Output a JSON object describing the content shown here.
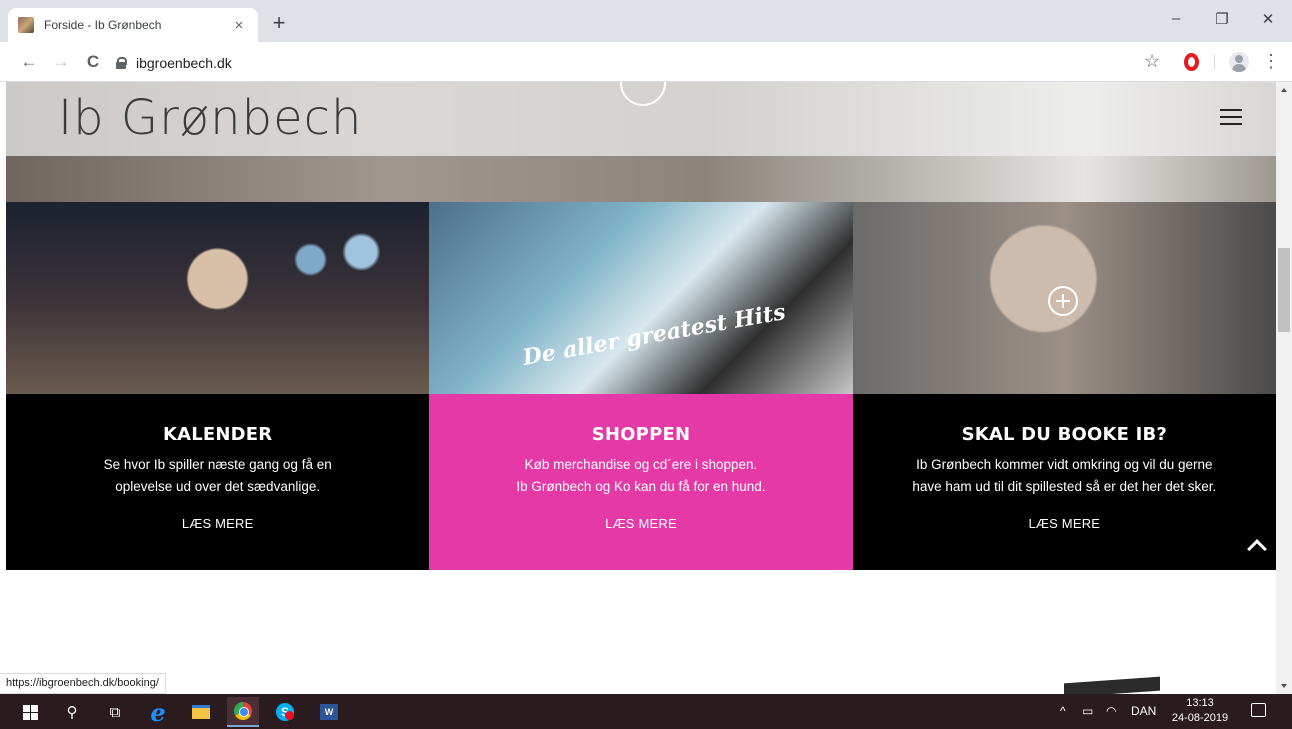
{
  "browser": {
    "tab_title": "Forside - Ib Grønbech",
    "tab_close": "×",
    "new_tab": "+",
    "url": "ibgroenbech.dk",
    "window_controls": {
      "minimize": "–",
      "restore": "❐",
      "close": "✕"
    },
    "nav": {
      "back": "←",
      "forward": "→",
      "reload": "C"
    },
    "star": "☆",
    "menu": "⋮",
    "status_url": "https://ibgroenbech.dk/booking/"
  },
  "site": {
    "logo": "Ib Grønbech",
    "columns": [
      {
        "title": "KALENDER",
        "text_line1": "Se hvor Ib spiller næste gang og få en",
        "text_line2": "oplevelse ud over det sædvanlige.",
        "link": "LÆS MERE",
        "bg": "#000000"
      },
      {
        "title": "SHOPPEN",
        "text_line1": "Køb merchandise og cd´ere i shoppen.",
        "text_line2": "Ib Grønbech og Ko kan du få for en hund.",
        "link": "LÆS MERE",
        "bg": "#e639a8",
        "photo_caption": "De aller greatest Hits"
      },
      {
        "title": "SKAL DU BOOKE IB?",
        "text_line1": "Ib Grønbech kommer vidt omkring og vil du gerne",
        "text_line2": "have ham ud til dit spillested så er det her det sker.",
        "link": "LÆS MERE",
        "bg": "#000000"
      }
    ]
  },
  "taskbar": {
    "language": "DAN",
    "time": "13:13",
    "date": "24-08-2019",
    "tray_chevron": "^",
    "search_glyph": "⚲",
    "taskview_glyph": "⧉",
    "ie_glyph": "e",
    "skype_glyph": "S",
    "word_glyph": "W"
  },
  "colors": {
    "pink": "#e639a8",
    "tabbar": "#dee1e6",
    "taskbar": "#2a1b1f"
  }
}
